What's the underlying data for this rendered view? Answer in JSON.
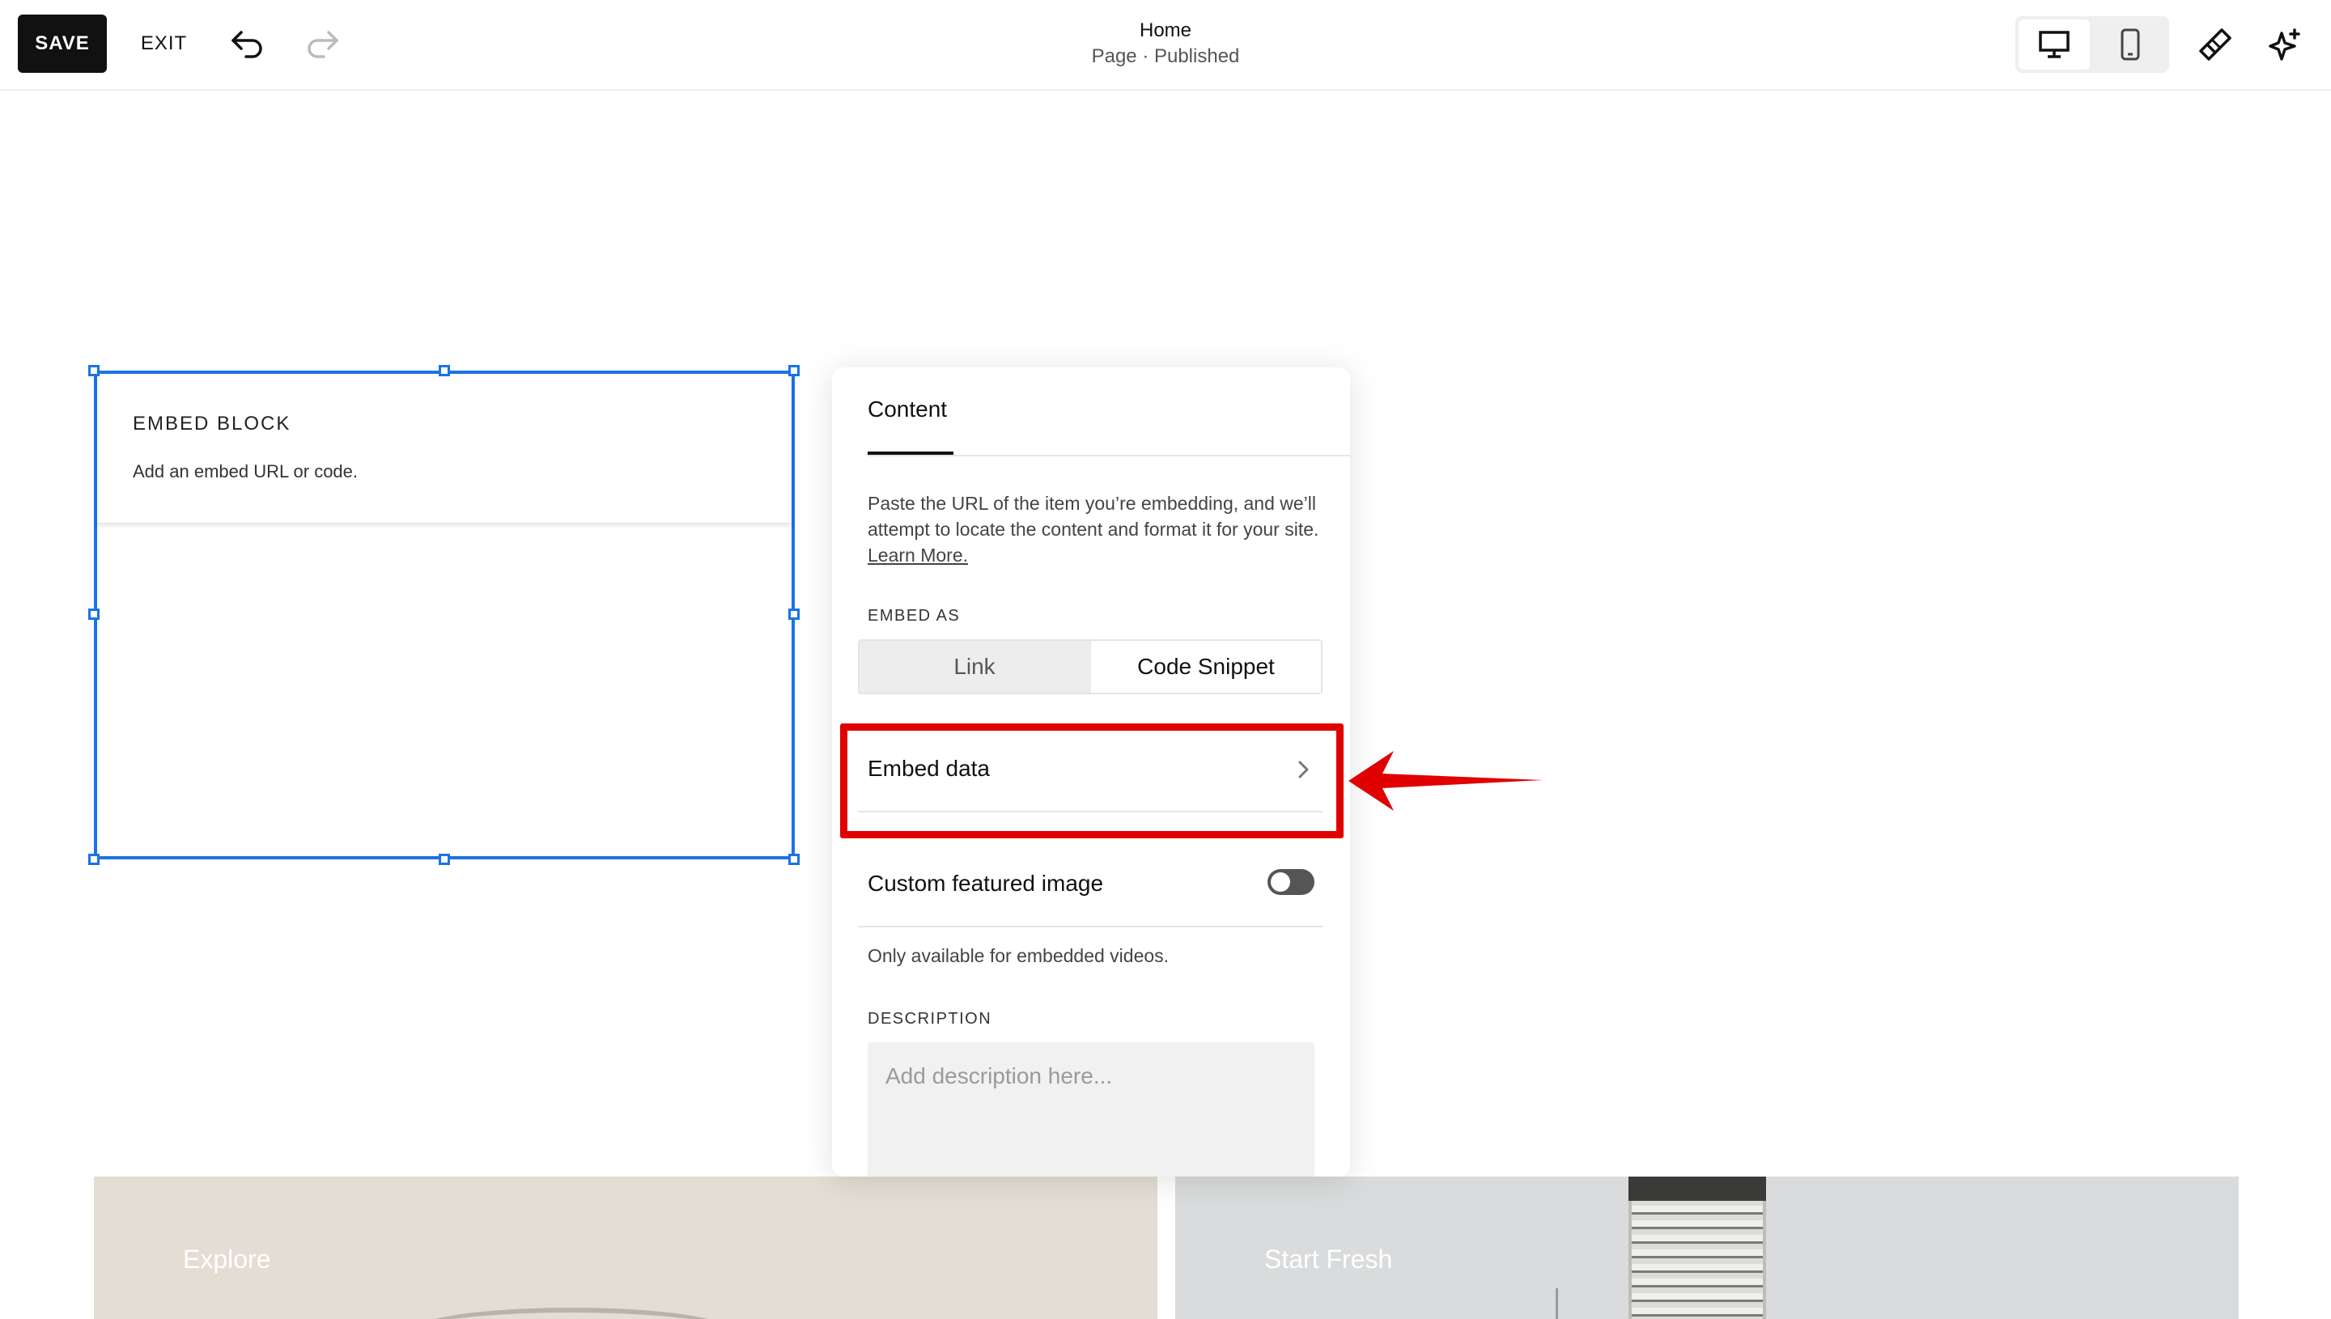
{
  "topbar": {
    "save_label": "SAVE",
    "exit_label": "EXIT",
    "page_title": "Home",
    "page_status": "Page · Published"
  },
  "icons": {
    "undo": "undo-arrow-icon",
    "redo": "redo-arrow-icon",
    "desktop": "desktop-monitor-icon",
    "mobile": "mobile-phone-icon",
    "design": "paintbrush-icon",
    "ai": "sparkle-icon"
  },
  "embed_block": {
    "title": "EMBED BLOCK",
    "subtitle": "Add an embed URL or code."
  },
  "panel": {
    "tab": "Content",
    "help_text": "Paste the URL of the item you’re embedding, and we’ll attempt to locate the content and format it for your site. ",
    "help_link": "Learn More.",
    "embed_as_label": "EMBED AS",
    "embed_as_options": [
      "Link",
      "Code Snippet"
    ],
    "embed_as_selected": "Code Snippet",
    "embed_data_label": "Embed data",
    "custom_featured_image_label": "Custom featured image",
    "custom_featured_image_on": false,
    "custom_featured_image_note": "Only available for embedded videos.",
    "description_label": "DESCRIPTION",
    "description_placeholder": "Add description here..."
  },
  "cards": {
    "explore": "Explore",
    "start_fresh": "Start Fresh"
  },
  "colors": {
    "accent_blue": "#1a73e8",
    "annotation_red": "#e00000",
    "save_bg": "#111111"
  }
}
